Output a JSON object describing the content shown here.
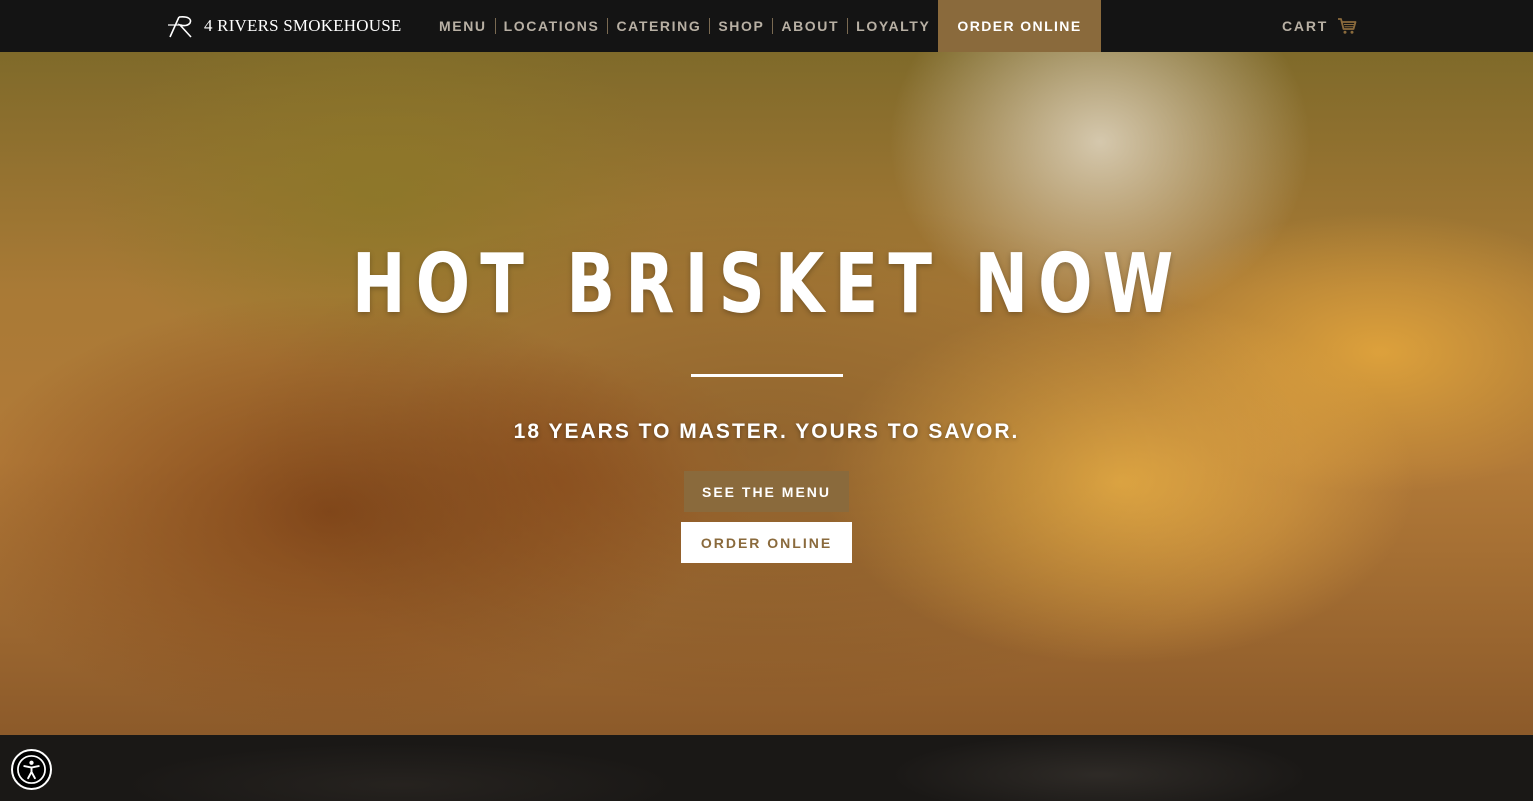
{
  "brand": {
    "name": "4 RIVERS SMOKEHOUSE",
    "logo_icon": "4r-monogram-icon"
  },
  "nav": {
    "items": [
      {
        "label": "MENU"
      },
      {
        "label": "LOCATIONS"
      },
      {
        "label": "CATERING"
      },
      {
        "label": "SHOP"
      },
      {
        "label": "ABOUT"
      },
      {
        "label": "LOYALTY"
      }
    ],
    "order_online": "ORDER ONLINE",
    "cart_label": "CART",
    "cart_icon": "shopping-cart-icon"
  },
  "hero": {
    "title": "HOT BRISKET NOW",
    "subtitle": "18 YEARS TO MASTER. YOURS TO SAVOR.",
    "menu_button": "SEE THE MENU",
    "order_button": "ORDER ONLINE"
  },
  "accessibility": {
    "icon": "accessibility-icon"
  },
  "colors": {
    "accent": "#8a6a3c",
    "nav_bg": "#141414",
    "nav_text": "#b8b0a4"
  }
}
